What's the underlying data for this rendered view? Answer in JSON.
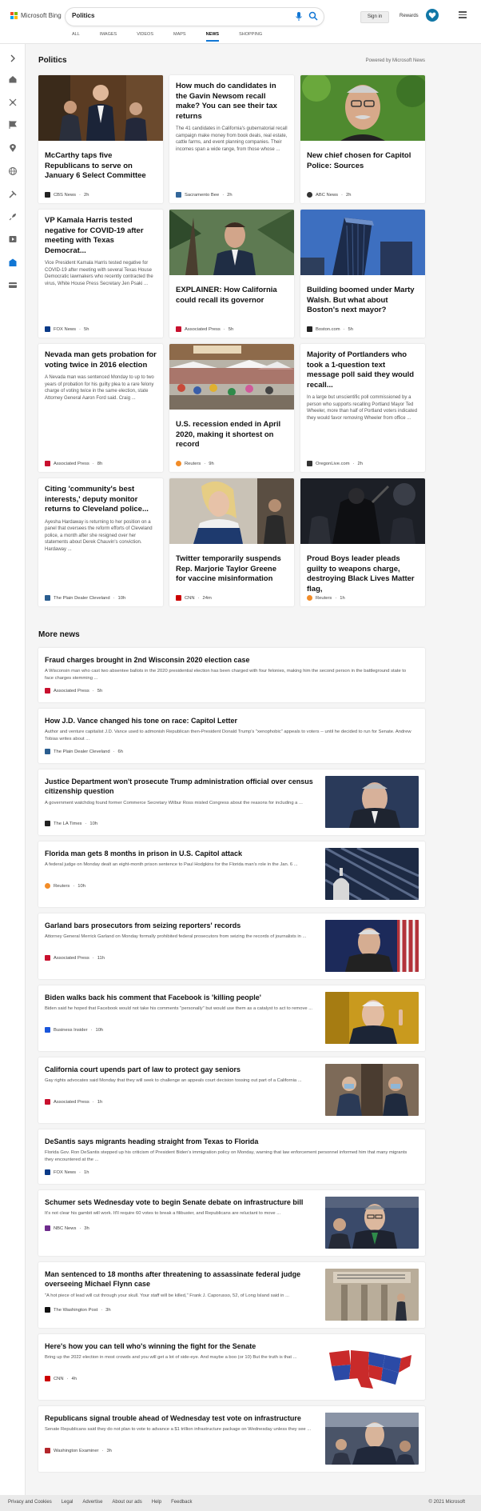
{
  "header": {
    "logo_text": "Microsoft Bing",
    "search_value": "Politics",
    "signin_label": "Sign in",
    "rewards_label": "Rewards",
    "tabs": [
      "ALL",
      "IMAGES",
      "VIDEOS",
      "MAPS",
      "NEWS",
      "SHOPPING"
    ],
    "active_tab": "NEWS"
  },
  "colors": {
    "accent": "#1176d4",
    "rewards": "#1177a6",
    "ms_red": "#f25022",
    "ms_green": "#7fba00",
    "ms_blue": "#00a4ef",
    "ms_yellow": "#ffb900"
  },
  "sidebar": {
    "icons": [
      "expand-icon",
      "home-icon",
      "crosshair-icon",
      "flag-icon",
      "location-icon",
      "globe-icon",
      "tools-icon",
      "rocket-icon",
      "video-icon",
      "building-icon",
      "card-icon"
    ]
  },
  "section": {
    "title": "Politics",
    "powered_by": "Powered by Microsoft News"
  },
  "cards": [
    {
      "title": "McCarthy taps five Republicans to serve on January 6 Select Committee",
      "desc": "",
      "source": "CBS News",
      "age": "2h"
    },
    {
      "title": "How much do candidates in the Gavin Newsom recall make? You can see their tax returns",
      "desc": "The 41 candidates in California's gubernatorial recall campaign make money from book deals, real estate, cattle farms, and event planning companies. Their incomes span a wide range, from those whose ...",
      "source": "Sacramento Bee",
      "age": "2h"
    },
    {
      "title": "New chief chosen for Capitol Police: Sources",
      "desc": "",
      "source": "ABC News",
      "age": "2h"
    },
    {
      "title": "VP Kamala Harris tested negative for COVID-19 after meeting with Texas Democrat...",
      "desc": "Vice President Kamala Harris tested negative for COVID-19 after meeting with several Texas House Democratic lawmakers who recently contracted the virus, White House Press Secretary Jen Psaki ...",
      "source": "FOX News",
      "age": "5h"
    },
    {
      "title": "EXPLAINER: How California could recall its governor",
      "desc": "",
      "source": "Associated Press",
      "age": "5h"
    },
    {
      "title": "Building boomed under Marty Walsh. But what about Boston's next mayor?",
      "desc": "",
      "source": "Boston.com",
      "age": "5h"
    },
    {
      "title": "Nevada man gets probation for voting twice in 2016 election",
      "desc": "A Nevada man was sentenced Monday to up to two years of probation for his guilty plea to a rare felony charge of voting twice in the same election, state Attorney General Aaron Ford said. Craig ...",
      "source": "Associated Press",
      "age": "8h"
    },
    {
      "title": "U.S. recession ended in April 2020, making it shortest on record",
      "desc": "",
      "source": "Reuters",
      "age": "9h"
    },
    {
      "title": "Majority of Portlanders who took a 1-question text message poll said they would recall...",
      "desc": "In a large but unscientific poll commissioned by a person who supports recalling Portland Mayor Ted Wheeler, more than half of Portland voters indicated they would favor removing Wheeler from office ...",
      "source": "OregonLive.com",
      "age": "2h"
    },
    {
      "title": "Citing 'community's best interests,' deputy monitor returns to Cleveland police...",
      "desc": "Ayesha Hardaway is returning to her position on a panel that oversees the reform efforts of Cleveland police, a month after she resigned over her statements about Derek Chauvin's conviction. Hardaway ...",
      "source": "The Plain Dealer Cleveland",
      "age": "10h"
    },
    {
      "title": "Twitter temporarily suspends Rep. Marjorie Taylor Greene for vaccine misinformation",
      "desc": "",
      "source": "CNN",
      "age": "24m"
    },
    {
      "title": "Proud Boys leader pleads guilty to weapons charge, destroying Black Lives Matter flag,",
      "desc": "",
      "source": "Reuters",
      "age": "1h"
    }
  ],
  "more_news": {
    "title": "More news",
    "items": [
      {
        "title": "Fraud charges brought in 2nd Wisconsin 2020 election case",
        "desc": "A Wisconsin man who cast two absentee ballots in the 2020 presidential election has been charged with four felonies, making him the second person in the battleground state to face charges stemming ...",
        "source": "Associated Press",
        "age": "5h"
      },
      {
        "title": "How J.D. Vance changed his tone on race: Capitol Letter",
        "desc": "Author and venture capitalist J.D. Vance used to admonish Republican then-President Donald Trump's \"xenophobic\" appeals to voters -- until he decided to run for Senate. Andrew Tobias writes about ...",
        "source": "The Plain Dealer Cleveland",
        "age": "6h"
      },
      {
        "title": "Justice Department won't prosecute Trump administration official over census citizenship question",
        "desc": "A government watchdog found former Commerce Secretary Wilbur Ross misled Congress about the reasons for including a ...",
        "source": "The LA Times",
        "age": "10h"
      },
      {
        "title": "Florida man gets 8 months in prison in U.S. Capitol attack",
        "desc": "A federal judge on Monday dealt an eight-month prison sentence to Paul Hodgkins for the Florida man's role in the Jan. 6 ...",
        "source": "Reuters",
        "age": "10h"
      },
      {
        "title": "Garland bars prosecutors from seizing reporters' records",
        "desc": "Attorney General Merrick Garland on Monday formally prohibited federal prosecutors from seizing the records of journalists in ...",
        "source": "Associated Press",
        "age": "11h"
      },
      {
        "title": "Biden walks back his comment that Facebook is 'killing people'",
        "desc": "Biden said he hoped that Facebook would not take his comments \"personally\" but would use them as a catalyst to act to remove ...",
        "source": "Business Insider",
        "age": "10h"
      },
      {
        "title": "California court upends part of law to protect gay seniors",
        "desc": "Gay rights advocates said Monday that they will seek to challenge an appeals court decision tossing out part of a California ...",
        "source": "Associated Press",
        "age": "1h"
      },
      {
        "title": "DeSantis says migrants heading straight from Texas to Florida",
        "desc": "Florida Gov. Ron DeSantis stepped up his criticism of President Biden's immigration policy on Monday, warning that law enforcement personnel informed him that many migrants they encountered at the ...",
        "source": "FOX News",
        "age": "1h"
      },
      {
        "title": "Schumer sets Wednesday vote to begin Senate debate on infrastructure bill",
        "desc": "It's not clear his gambit will work. It'll require 60 votes to break a filibuster, and Republicans are reluctant to move ...",
        "source": "NBC News",
        "age": "3h"
      },
      {
        "title": "Man sentenced to 18 months after threatening to assassinate federal judge overseeing Michael Flynn case",
        "desc": "\"A hot piece of lead will cut through your skull. Your staff will be killed,\" Frank J. Caporusso, 52, of Long Island said in ...",
        "source": "The Washington Post",
        "age": "3h"
      },
      {
        "title": "Here's how you can tell who's winning the fight for the Senate",
        "desc": "Bring up the 2022 election in most crowds and you will get a lot of side-eye. And maybe a boo (or 10) But the truth is that ...",
        "source": "CNN",
        "age": "4h"
      },
      {
        "title": "Republicans signal trouble ahead of Wednesday test vote on infrastructure",
        "desc": "Senate Republicans said they do not plan to vote to advance a $1 trillion infrastructure package on Wednesday unless they see ...",
        "source": "Washington Examiner",
        "age": "3h"
      }
    ]
  },
  "footer": {
    "links": [
      "Privacy and Cookies",
      "Legal",
      "Advertise",
      "About our ads",
      "Help",
      "Feedback"
    ],
    "copyright": "© 2021 Microsoft"
  }
}
